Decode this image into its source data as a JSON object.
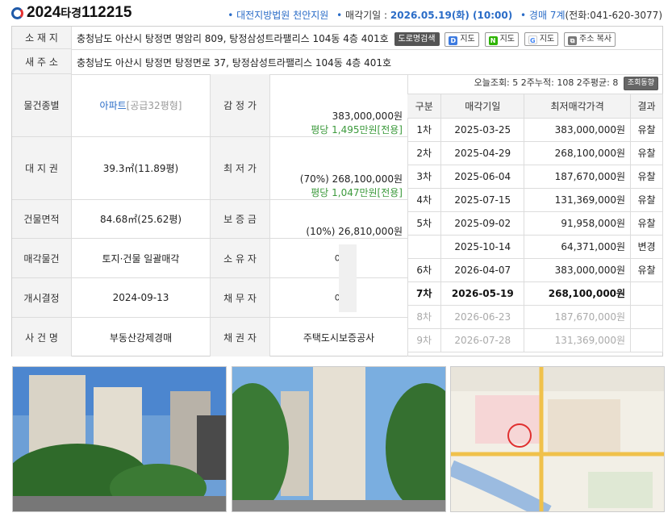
{
  "header": {
    "case_year": "2024",
    "case_type": "타경",
    "case_no": "112215",
    "court": "대전지방법원 천안지원",
    "sale_label": "매각기일 :",
    "sale_date": "2026.05.19(화) (10:00)",
    "dept": "경매 7계",
    "phone": "(전화:041-620-3077)"
  },
  "address": {
    "label": "소 재 지",
    "value": "충청남도 아산시 탕정면 명암리 809, 탕정삼성트라팰리스 104동 4층 401호",
    "buttons": [
      "도로명검색",
      "지도",
      "지도",
      "지도",
      "주소 복사"
    ],
    "new_label": "새 주 소",
    "new_value": "충청남도 아산시 탕정면 탕정면로 37, 탕정삼성트라팰리스 104동 4층 401호"
  },
  "details": [
    {
      "label": "물건종별",
      "value": "아파트",
      "value_sub": "[공급32평형]",
      "label2": "감 정 가",
      "value2": "383,000,000원",
      "value2_sub": "평당 1,495만원[전용]"
    },
    {
      "label": "대 지 권",
      "value": "39.3㎡(11.89평)",
      "label2": "최 저 가",
      "value2": "(70%) 268,100,000원",
      "value2_sub": "평당 1,047만원[전용]"
    },
    {
      "label": "건물면적",
      "value": "84.68㎡(25.62평)",
      "label2": "보 증 금",
      "value2": "(10%) 26,810,000원"
    },
    {
      "label": "매각물건",
      "value": "토지·건물 일괄매각",
      "label2": "소 유 자",
      "value2": "이"
    },
    {
      "label": "개시결정",
      "value": "2024-09-13",
      "label2": "채 무 자",
      "value2": "이"
    },
    {
      "label": "사 건 명",
      "value": "부동산강제경매",
      "label2": "채 권 자",
      "value2": "주택도시보증공사"
    }
  ],
  "views": {
    "text": "오늘조회: 5  2주누적: 108  2주평균: 8",
    "button": "조회동향"
  },
  "history": {
    "headers": [
      "구분",
      "매각기일",
      "최저매각가격",
      "결과"
    ],
    "rows": [
      {
        "round": "1차",
        "date": "2025-03-25",
        "price": "383,000,000원",
        "result": "유찰",
        "state": ""
      },
      {
        "round": "2차",
        "date": "2025-04-29",
        "price": "268,100,000원",
        "result": "유찰",
        "state": ""
      },
      {
        "round": "3차",
        "date": "2025-06-04",
        "price": "187,670,000원",
        "result": "유찰",
        "state": ""
      },
      {
        "round": "4차",
        "date": "2025-07-15",
        "price": "131,369,000원",
        "result": "유찰",
        "state": ""
      },
      {
        "round": "5차",
        "date": "2025-09-02",
        "price": "91,958,000원",
        "result": "유찰",
        "state": ""
      },
      {
        "round": "",
        "date": "2025-10-14",
        "price": "64,371,000원",
        "result": "변경",
        "state": ""
      },
      {
        "round": "6차",
        "date": "2026-04-07",
        "price": "383,000,000원",
        "result": "유찰",
        "state": ""
      },
      {
        "round": "7차",
        "date": "2026-05-19",
        "price": "268,100,000원",
        "result": "",
        "state": "cur"
      },
      {
        "round": "8차",
        "date": "2026-06-23",
        "price": "187,670,000원",
        "result": "",
        "state": "fut"
      },
      {
        "round": "9차",
        "date": "2026-07-28",
        "price": "131,369,000원",
        "result": "",
        "state": "fut"
      }
    ]
  },
  "colors": {
    "accent": "#2a6cc7",
    "green": "#3c9a3c",
    "label_bg": "#f3f3f3"
  }
}
